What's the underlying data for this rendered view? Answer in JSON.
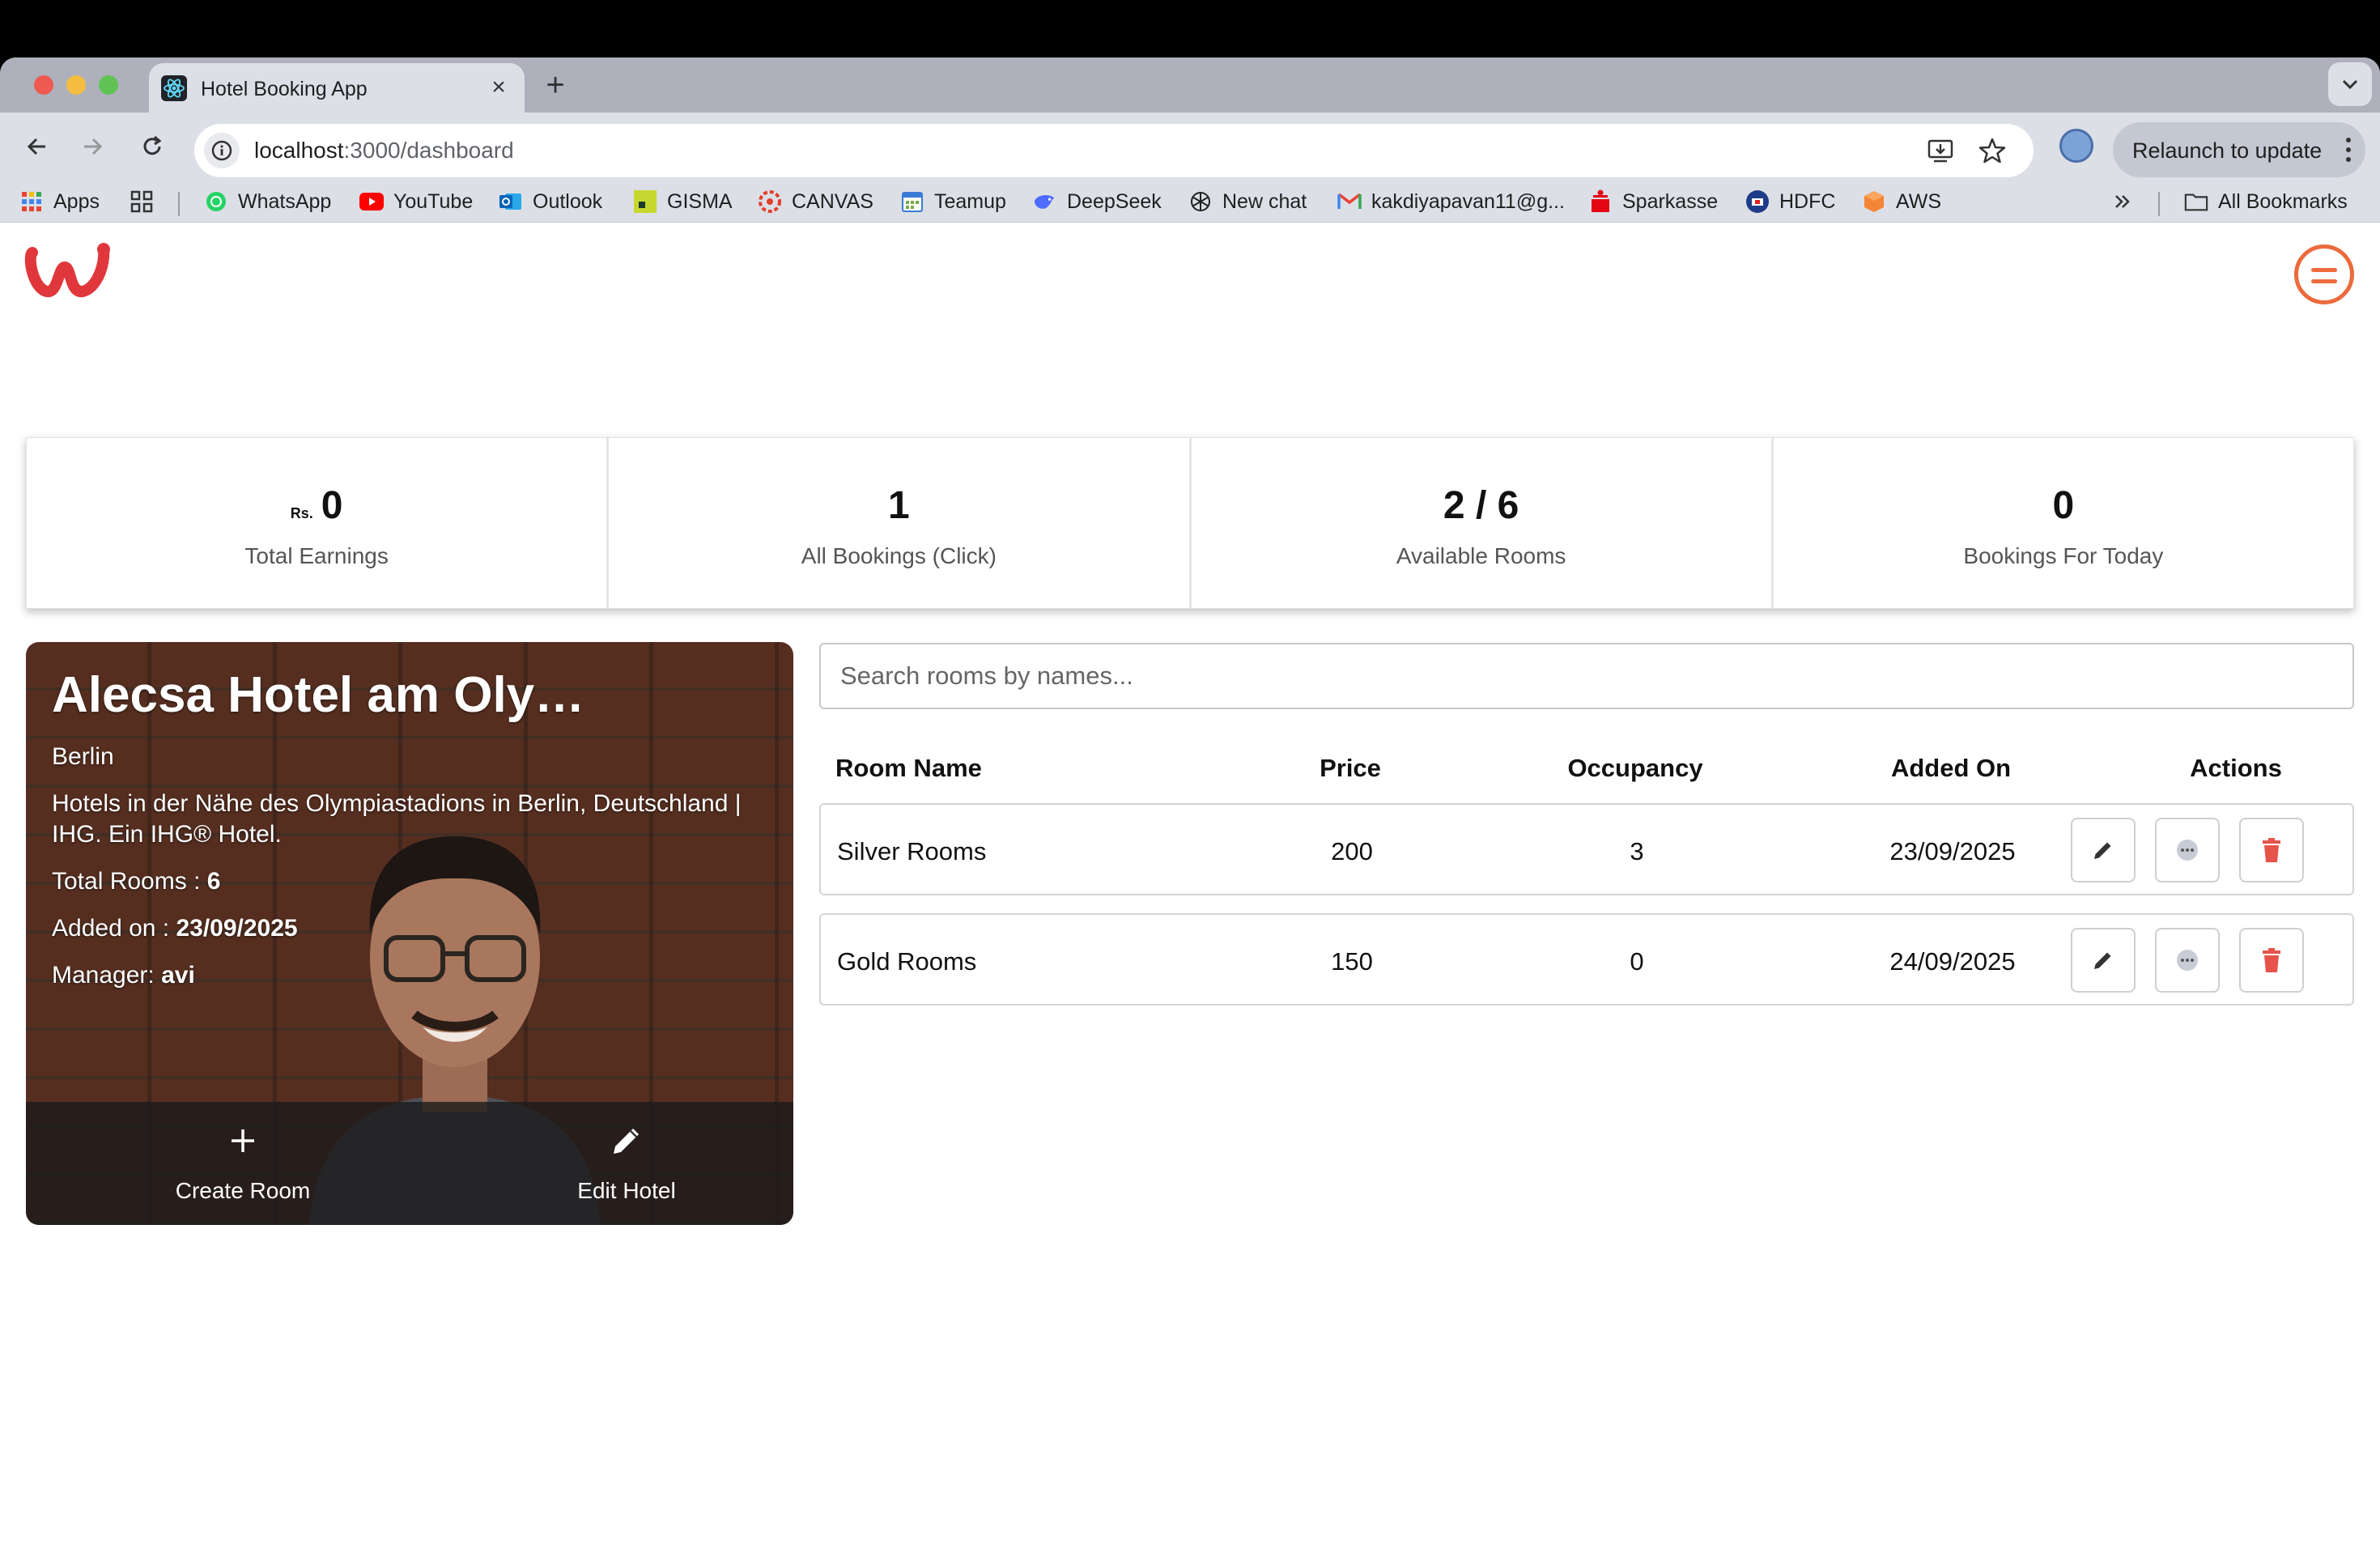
{
  "browser": {
    "tab_title": "Hotel Booking App",
    "url_host": "localhost",
    "url_path": ":3000/dashboard",
    "relaunch_label": "Relaunch to update",
    "bookmarks": [
      "Apps",
      "WhatsApp",
      "YouTube",
      "Outlook",
      "GISMA",
      "CANVAS",
      "Teamup",
      "DeepSeek",
      "New chat",
      "kakdiyapavan11@g...",
      "Sparkasse",
      "HDFC",
      "AWS"
    ],
    "all_bookmarks_label": "All Bookmarks"
  },
  "stats": [
    {
      "prefix": "Rs.",
      "value": "0",
      "label": "Total Earnings"
    },
    {
      "prefix": "",
      "value": "1",
      "label": "All Bookings (Click)"
    },
    {
      "prefix": "",
      "value": "2 / 6",
      "label": "Available Rooms"
    },
    {
      "prefix": "",
      "value": "0",
      "label": "Bookings For Today"
    }
  ],
  "hotel": {
    "name": "Alecsa Hotel am Oly…",
    "city": "Berlin",
    "description": "Hotels in der Nähe des Olympiastadions in Berlin, Deutschland | IHG. Ein IHG® Hotel.",
    "total_rooms_label": "Total Rooms : ",
    "total_rooms": "6",
    "added_on_label": "Added on : ",
    "added_on": "23/09/2025",
    "manager_label": "Manager: ",
    "manager": "avi",
    "create_room_label": "Create Room",
    "edit_hotel_label": "Edit Hotel"
  },
  "rooms": {
    "search_placeholder": "Search rooms by names...",
    "headers": [
      "Room Name",
      "Price",
      "Occupancy",
      "Added On",
      "Actions"
    ],
    "rows": [
      {
        "name": "Silver Rooms",
        "price": "200",
        "occupancy": "3",
        "added_on": "23/09/2025"
      },
      {
        "name": "Gold Rooms",
        "price": "150",
        "occupancy": "0",
        "added_on": "24/09/2025"
      }
    ]
  },
  "colors": {
    "accent": "#ec6a3c",
    "logo": "#e0373c",
    "delete": "#e5534b"
  },
  "icons": [
    "react-icon",
    "info-icon",
    "install-icon",
    "star-icon",
    "menu-icon",
    "plus-icon",
    "pencil-icon",
    "more-icon",
    "trash-icon"
  ]
}
